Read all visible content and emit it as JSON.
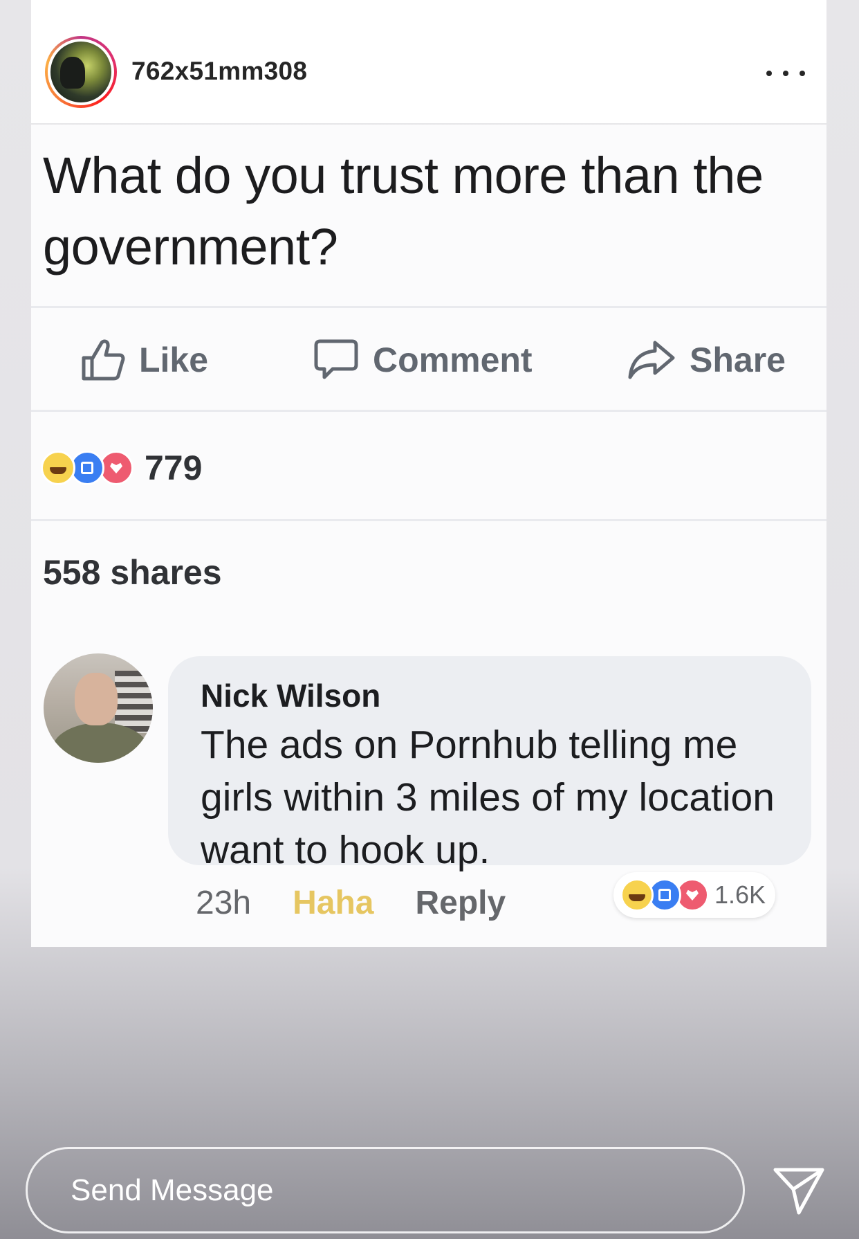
{
  "story": {
    "username": "762x51mm308",
    "more_icon": "more-horizontal-icon"
  },
  "post": {
    "text": "What do you trust more than the government?",
    "actions": {
      "like": "Like",
      "comment": "Comment",
      "share": "Share"
    },
    "reactions_count": "779",
    "shares": "558 shares"
  },
  "comment": {
    "author": "Nick Wilson",
    "text": "The ads on Pornhub telling me girls within 3 miles of my location want to hook up.",
    "time": "23h",
    "reaction_label": "Haha",
    "reply": "Reply",
    "reactions_count": "1.6K"
  },
  "message_bar": {
    "placeholder": "Send Message",
    "send_icon": "paper-plane-icon"
  },
  "colors": {
    "haha": "#f7d24e",
    "like": "#3a7ef2",
    "love": "#ee5b70"
  }
}
